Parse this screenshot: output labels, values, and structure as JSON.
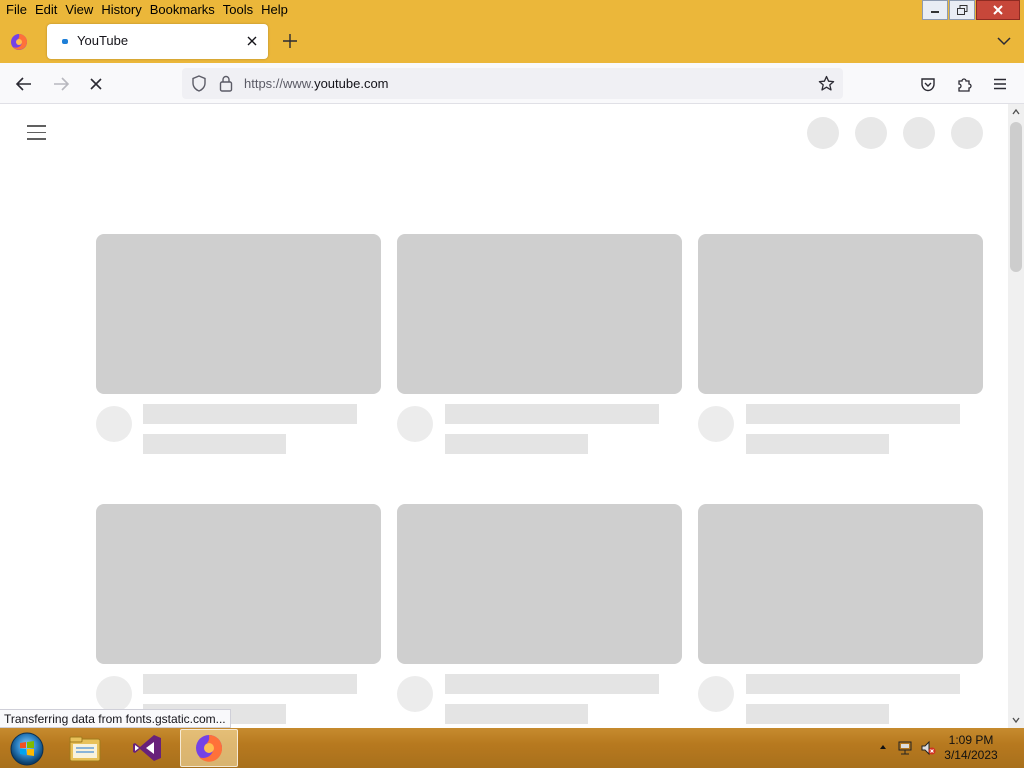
{
  "menubar": {
    "items": [
      {
        "label": "File"
      },
      {
        "label": "Edit"
      },
      {
        "label": "View"
      },
      {
        "label": "History"
      },
      {
        "label": "Bookmarks"
      },
      {
        "label": "Tools"
      },
      {
        "label": "Help"
      }
    ]
  },
  "window_controls": [
    "minimize-icon",
    "restore-icon",
    "close-icon"
  ],
  "tab": {
    "title": "YouTube",
    "favicon": "youtube-loading-icon",
    "close_icon": "close-icon"
  },
  "tabstrip": {
    "new_tab_icon": "plus-icon",
    "list_all_tabs_icon": "chevron-down-icon"
  },
  "navbar": {
    "back_icon": "arrow-left-icon",
    "forward_icon": "arrow-right-icon",
    "stop_icon": "stop-icon",
    "url_prefix": "https://www.",
    "url_host": "youtube.com",
    "tracking_icon": "shield-icon",
    "lock_icon": "lock-icon",
    "bookmark_icon": "star-icon",
    "pocket_icon": "pocket-icon",
    "extensions_icon": "puzzle-icon",
    "menu_icon": "hamburger-icon"
  },
  "page": {
    "menu_icon": "hamburger-icon",
    "placeholder_color": "#cfcfcf",
    "placeholder_rows": 2,
    "placeholder_columns": 3
  },
  "status_panel": {
    "text": "Transferring data from fonts.gstatic.com..."
  },
  "taskbar": {
    "start_icon": "windows-start-orb-icon",
    "apps": [
      {
        "name": "file-explorer-icon",
        "active": false
      },
      {
        "name": "visual-studio-icon",
        "active": false
      },
      {
        "name": "firefox-icon",
        "active": true
      }
    ],
    "clock": {
      "time": "1:09 PM",
      "date": "3/14/2023"
    },
    "tray_icons": [
      "chevron-up-icon",
      "network-icon",
      "volume-muted-icon"
    ]
  },
  "colors": {
    "titlebar": "#ebb73a",
    "taskbar": "#b7791f",
    "placeholder": "#cfcfcf"
  }
}
